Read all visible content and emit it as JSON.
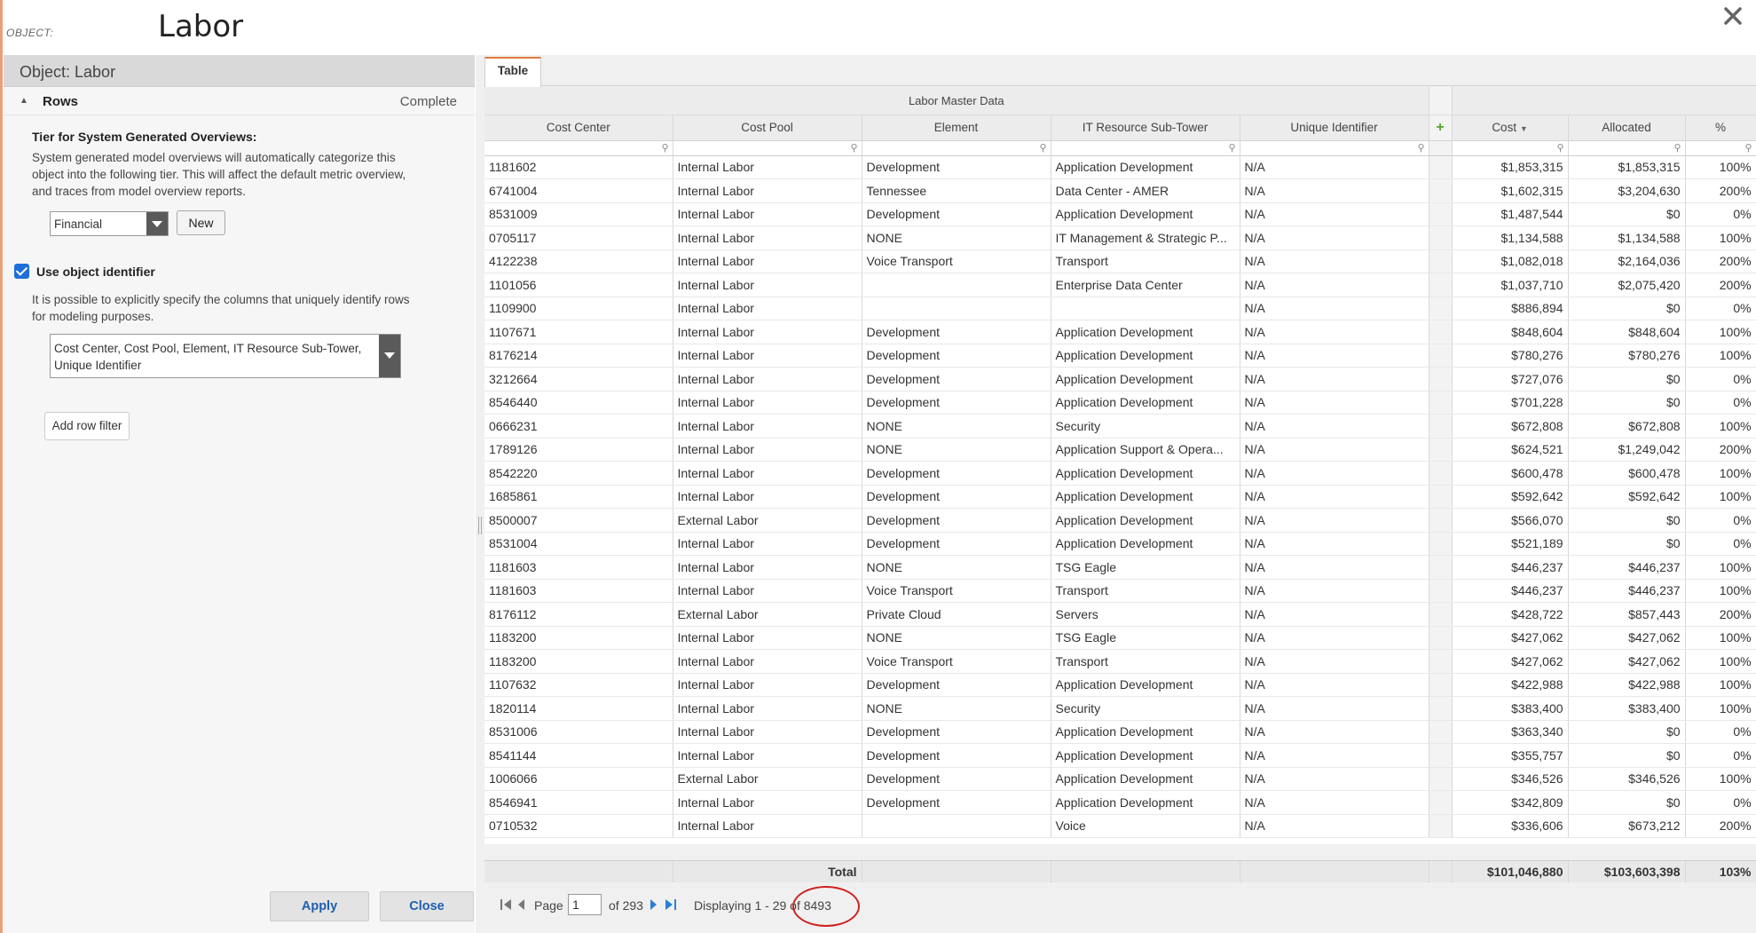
{
  "header": {
    "object_label": "OBJECT:",
    "title": "Labor"
  },
  "left_panel": {
    "object_heading": "Object: Labor",
    "rows_section": {
      "label": "Rows",
      "status": "Complete"
    },
    "tier": {
      "title": "Tier for System Generated Overviews:",
      "description": "System generated model overviews will automatically categorize this object into the following tier. This will affect the default metric overview, and traces from model overview reports.",
      "selected": "Financial",
      "new_button": "New"
    },
    "identifier": {
      "checkbox_label": "Use object identifier",
      "checked": true,
      "description": "It is possible to explicitly specify the columns that uniquely identify rows for modeling purposes.",
      "selected_columns": "Cost Center, Cost Pool, Element, IT Resource Sub-Tower, Unique Identifier"
    },
    "add_row_filter_button": "Add row filter",
    "apply_button": "Apply",
    "close_button": "Close"
  },
  "right_panel": {
    "tab_label": "Table",
    "group_header": "Labor Master Data",
    "columns": [
      "Cost Center",
      "Cost Pool",
      "Element",
      "IT Resource Sub-Tower",
      "Unique Identifier",
      "Cost",
      "Allocated",
      "%"
    ],
    "rows": [
      [
        "1181602",
        "Internal Labor",
        "Development",
        "Application Development",
        "N/A",
        "$1,853,315",
        "$1,853,315",
        "100%"
      ],
      [
        "6741004",
        "Internal Labor",
        "Tennessee",
        "Data Center - AMER",
        "N/A",
        "$1,602,315",
        "$3,204,630",
        "200%"
      ],
      [
        "8531009",
        "Internal Labor",
        "Development",
        "Application Development",
        "N/A",
        "$1,487,544",
        "$0",
        "0%"
      ],
      [
        "0705117",
        "Internal Labor",
        "NONE",
        "IT Management & Strategic P...",
        "N/A",
        "$1,134,588",
        "$1,134,588",
        "100%"
      ],
      [
        "4122238",
        "Internal Labor",
        "Voice Transport",
        "Transport",
        "N/A",
        "$1,082,018",
        "$2,164,036",
        "200%"
      ],
      [
        "1101056",
        "Internal Labor",
        "",
        "Enterprise Data Center",
        "N/A",
        "$1,037,710",
        "$2,075,420",
        "200%"
      ],
      [
        "1109900",
        "Internal Labor",
        "",
        "",
        "N/A",
        "$886,894",
        "$0",
        "0%"
      ],
      [
        "1107671",
        "Internal Labor",
        "Development",
        "Application Development",
        "N/A",
        "$848,604",
        "$848,604",
        "100%"
      ],
      [
        "8176214",
        "Internal Labor",
        "Development",
        "Application Development",
        "N/A",
        "$780,276",
        "$780,276",
        "100%"
      ],
      [
        "3212664",
        "Internal Labor",
        "Development",
        "Application Development",
        "N/A",
        "$727,076",
        "$0",
        "0%"
      ],
      [
        "8546440",
        "Internal Labor",
        "Development",
        "Application Development",
        "N/A",
        "$701,228",
        "$0",
        "0%"
      ],
      [
        "0666231",
        "Internal Labor",
        "NONE",
        "Security",
        "N/A",
        "$672,808",
        "$672,808",
        "100%"
      ],
      [
        "1789126",
        "Internal Labor",
        "NONE",
        "Application Support & Opera...",
        "N/A",
        "$624,521",
        "$1,249,042",
        "200%"
      ],
      [
        "8542220",
        "Internal Labor",
        "Development",
        "Application Development",
        "N/A",
        "$600,478",
        "$600,478",
        "100%"
      ],
      [
        "1685861",
        "Internal Labor",
        "Development",
        "Application Development",
        "N/A",
        "$592,642",
        "$592,642",
        "100%"
      ],
      [
        "8500007",
        "External Labor",
        "Development",
        "Application Development",
        "N/A",
        "$566,070",
        "$0",
        "0%"
      ],
      [
        "8531004",
        "Internal Labor",
        "Development",
        "Application Development",
        "N/A",
        "$521,189",
        "$0",
        "0%"
      ],
      [
        "1181603",
        "Internal Labor",
        "NONE",
        "TSG Eagle",
        "N/A",
        "$446,237",
        "$446,237",
        "100%"
      ],
      [
        "1181603",
        "Internal Labor",
        "Voice Transport",
        "Transport",
        "N/A",
        "$446,237",
        "$446,237",
        "100%"
      ],
      [
        "8176112",
        "External Labor",
        "Private Cloud",
        "Servers",
        "N/A",
        "$428,722",
        "$857,443",
        "200%"
      ],
      [
        "1183200",
        "Internal Labor",
        "NONE",
        "TSG Eagle",
        "N/A",
        "$427,062",
        "$427,062",
        "100%"
      ],
      [
        "1183200",
        "Internal Labor",
        "Voice Transport",
        "Transport",
        "N/A",
        "$427,062",
        "$427,062",
        "100%"
      ],
      [
        "1107632",
        "Internal Labor",
        "Development",
        "Application Development",
        "N/A",
        "$422,988",
        "$422,988",
        "100%"
      ],
      [
        "1820114",
        "Internal Labor",
        "NONE",
        "Security",
        "N/A",
        "$383,400",
        "$383,400",
        "100%"
      ],
      [
        "8531006",
        "Internal Labor",
        "Development",
        "Application Development",
        "N/A",
        "$363,340",
        "$0",
        "0%"
      ],
      [
        "8541144",
        "Internal Labor",
        "Development",
        "Application Development",
        "N/A",
        "$355,757",
        "$0",
        "0%"
      ],
      [
        "1006066",
        "External Labor",
        "Development",
        "Application Development",
        "N/A",
        "$346,526",
        "$346,526",
        "100%"
      ],
      [
        "8546941",
        "Internal Labor",
        "Development",
        "Application Development",
        "N/A",
        "$342,809",
        "$0",
        "0%"
      ],
      [
        "0710532",
        "Internal Labor",
        "",
        "Voice",
        "N/A",
        "$336,606",
        "$673,212",
        "200%"
      ]
    ],
    "totals": {
      "label": "Total",
      "cost": "$101,046,880",
      "allocated": "$103,603,398",
      "percent": "103%"
    },
    "pager": {
      "page_label": "Page",
      "current_page": "1",
      "of_pages": "of 293",
      "displaying": "Displaying 1 - 29 of 8493"
    }
  },
  "icons": [
    "close-icon",
    "collapse-caret-icon",
    "dropdown-arrow-icon",
    "checkbox-icon",
    "filter-search-icon",
    "add-column-icon",
    "sort-desc-icon",
    "first-page-icon",
    "prev-page-icon",
    "next-page-icon",
    "last-page-icon"
  ],
  "colors": {
    "accent": "#e07b3c",
    "link_blue": "#1e5fb0",
    "checkbox_blue": "#1e6fd9",
    "add_green": "#5aa02c",
    "annotation_red": "#d02020"
  }
}
